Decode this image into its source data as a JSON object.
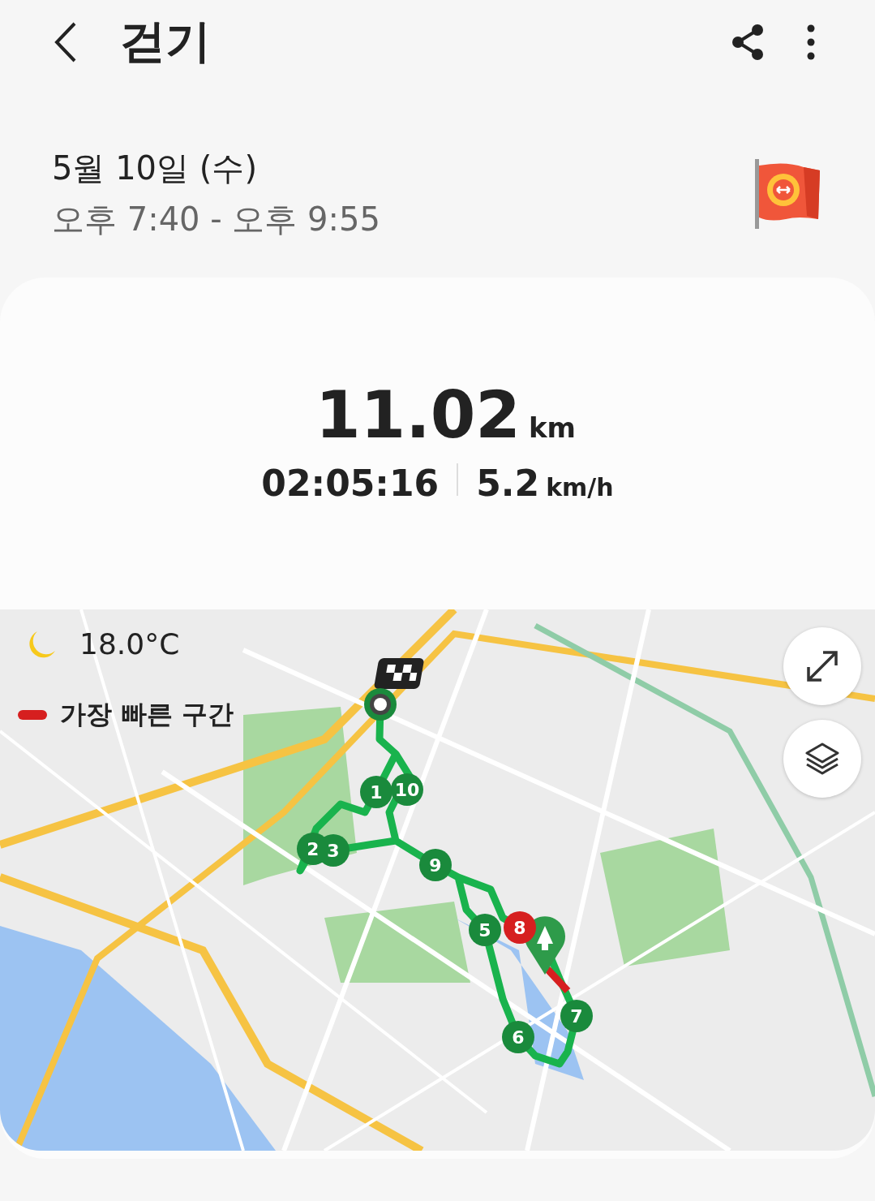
{
  "header": {
    "title": "걷기"
  },
  "session": {
    "date": "5월 10일 (수)",
    "time_range": "오후 7:40 - 오후 9:55"
  },
  "summary": {
    "distance": "11.02",
    "distance_unit": "km",
    "duration": "02:05:16",
    "speed": "5.2",
    "speed_unit": "km/h"
  },
  "map": {
    "temperature": "18.0°C",
    "legend": "가장 빠른 구간",
    "markers": [
      {
        "label": "1",
        "color": "#1a8a3c"
      },
      {
        "label": "10",
        "color": "#1a8a3c"
      },
      {
        "label": "2",
        "color": "#1a8a3c"
      },
      {
        "label": "3",
        "color": "#1a8a3c"
      },
      {
        "label": "9",
        "color": "#1a8a3c"
      },
      {
        "label": "5",
        "color": "#1a8a3c"
      },
      {
        "label": "8",
        "color": "#d61f1f"
      },
      {
        "label": "7",
        "color": "#1a8a3c"
      },
      {
        "label": "6",
        "color": "#1a8a3c"
      }
    ]
  }
}
